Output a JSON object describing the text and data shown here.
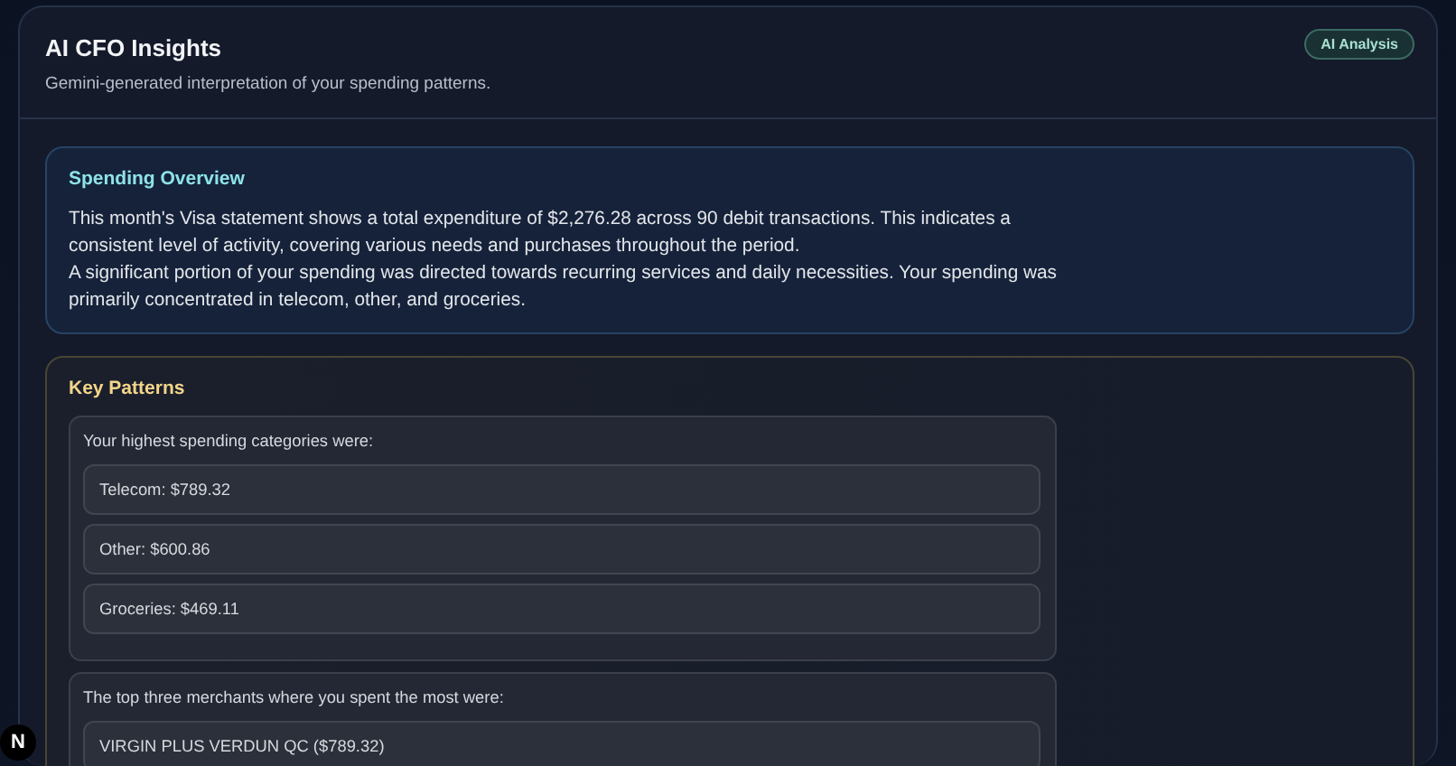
{
  "header": {
    "title": "AI CFO Insights",
    "subtitle": "Gemini-generated interpretation of your spending patterns.",
    "badge": "AI Analysis"
  },
  "sections": [
    {
      "kind": "overview",
      "title": "Spending Overview",
      "paragraphs": [
        "This month's Visa statement shows a total expenditure of $2,276.28 across 90 debit transactions. This indicates a consistent level of activity, covering various needs and purchases throughout the period.",
        "A significant portion of your spending was directed towards recurring services and daily necessities. Your spending was primarily concentrated in telecom, other, and groceries."
      ]
    },
    {
      "kind": "patterns",
      "title": "Key Patterns",
      "groups": [
        {
          "intro": "Your highest spending categories were:",
          "items": [
            "Telecom: $789.32",
            "Other: $600.86",
            "Groceries: $469.11"
          ]
        },
        {
          "intro": "The top three merchants where you spent the most were:",
          "items": [
            "VIRGIN PLUS VERDUN QC ($789.32)"
          ]
        }
      ]
    }
  ],
  "dev_badge": "N"
}
